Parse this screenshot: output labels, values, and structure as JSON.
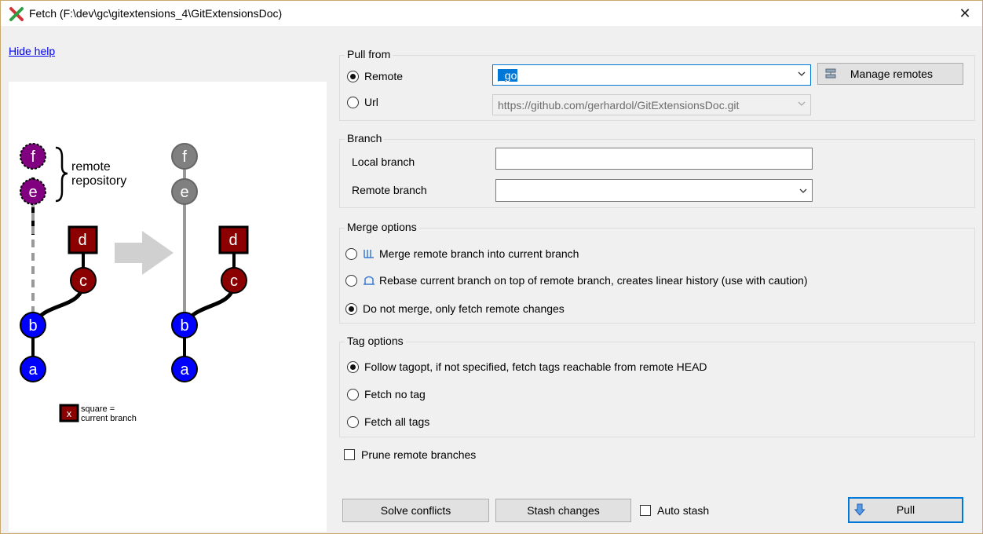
{
  "window": {
    "title": "Fetch (F:\\dev\\gc\\gitextensions_4\\GitExtensionsDoc)",
    "close_glyph": "✕"
  },
  "help": {
    "hide_label": "Hide help",
    "diagram": {
      "left_commits": [
        "f",
        "e",
        "d",
        "c",
        "b",
        "a"
      ],
      "right_commits": [
        "f",
        "e",
        "d",
        "c",
        "b",
        "a"
      ],
      "brace_label_line1": "remote",
      "brace_label_line2": "repository",
      "legend_box": "x",
      "legend_line1": "square =",
      "legend_line2": "current branch"
    }
  },
  "pull_from": {
    "title": "Pull from",
    "remote_label": "Remote",
    "remote_value": "_go",
    "manage_remotes_label": "Manage remotes",
    "url_label": "Url",
    "url_value": "https://github.com/gerhardol/GitExtensionsDoc.git",
    "selected": "remote"
  },
  "branch": {
    "title": "Branch",
    "local_label": "Local branch",
    "local_value": "",
    "remote_label": "Remote branch",
    "remote_value": ""
  },
  "merge_options": {
    "title": "Merge options",
    "options": [
      "Merge remote branch into current branch",
      "Rebase current branch on top of remote branch, creates linear history (use with caution)",
      "Do not merge, only fetch remote changes"
    ],
    "selected_index": 2
  },
  "tag_options": {
    "title": "Tag options",
    "options": [
      "Follow tagopt, if not specified, fetch tags reachable from remote HEAD",
      "Fetch no tag",
      "Fetch all tags"
    ],
    "selected_index": 0
  },
  "prune": {
    "label": "Prune remote branches",
    "checked": false
  },
  "footer": {
    "solve_conflicts_label": "Solve conflicts",
    "stash_changes_label": "Stash changes",
    "auto_stash_label": "Auto stash",
    "auto_stash_checked": false,
    "pull_label": "Pull"
  },
  "colors": {
    "remote_commit": "#800080",
    "local_commit": "#0000ff",
    "current_branch": "#8b0000",
    "ghost_commit": "#808080",
    "accent": "#0078d7"
  }
}
